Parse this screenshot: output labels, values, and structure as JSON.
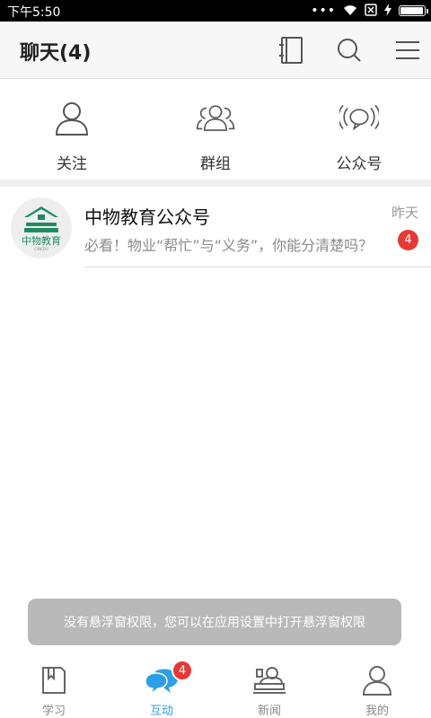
{
  "status_bar": {
    "time": "下午5:50",
    "battery_level": 0.95,
    "icons": [
      "dots-icon",
      "wifi-icon",
      "sim-x-icon",
      "charging-icon",
      "battery-icon"
    ]
  },
  "header": {
    "title": "聊天(4)",
    "actions": [
      "contacts-book-icon",
      "search-icon",
      "menu-icon"
    ]
  },
  "categories": [
    {
      "label": "关注",
      "icon": "person-icon"
    },
    {
      "label": "群组",
      "icon": "group-icon"
    },
    {
      "label": "公众号",
      "icon": "broadcast-icon"
    }
  ],
  "chats": [
    {
      "name": "中物教育公众号",
      "time": "昨天",
      "preview": "必看！物业“帮忙”与“义务”，你能分清楚吗？",
      "unread": "4",
      "avatar": {
        "logo_text": "中物教育",
        "sub_text": "CWEDU"
      }
    }
  ],
  "toast": "没有悬浮窗权限，您可以在应用设置中打开悬浮窗权限",
  "tabbar": [
    {
      "label": "学习",
      "icon": "book-icon",
      "active": false
    },
    {
      "label": "互动",
      "icon": "chat-bubbles-icon",
      "active": true,
      "badge": "4"
    },
    {
      "label": "新闻",
      "icon": "news-icon",
      "active": false
    },
    {
      "label": "我的",
      "icon": "profile-icon",
      "active": false
    }
  ],
  "colors": {
    "accent": "#2d9ee8",
    "badge": "#e53935",
    "logo_green": "#1f8a5e"
  }
}
